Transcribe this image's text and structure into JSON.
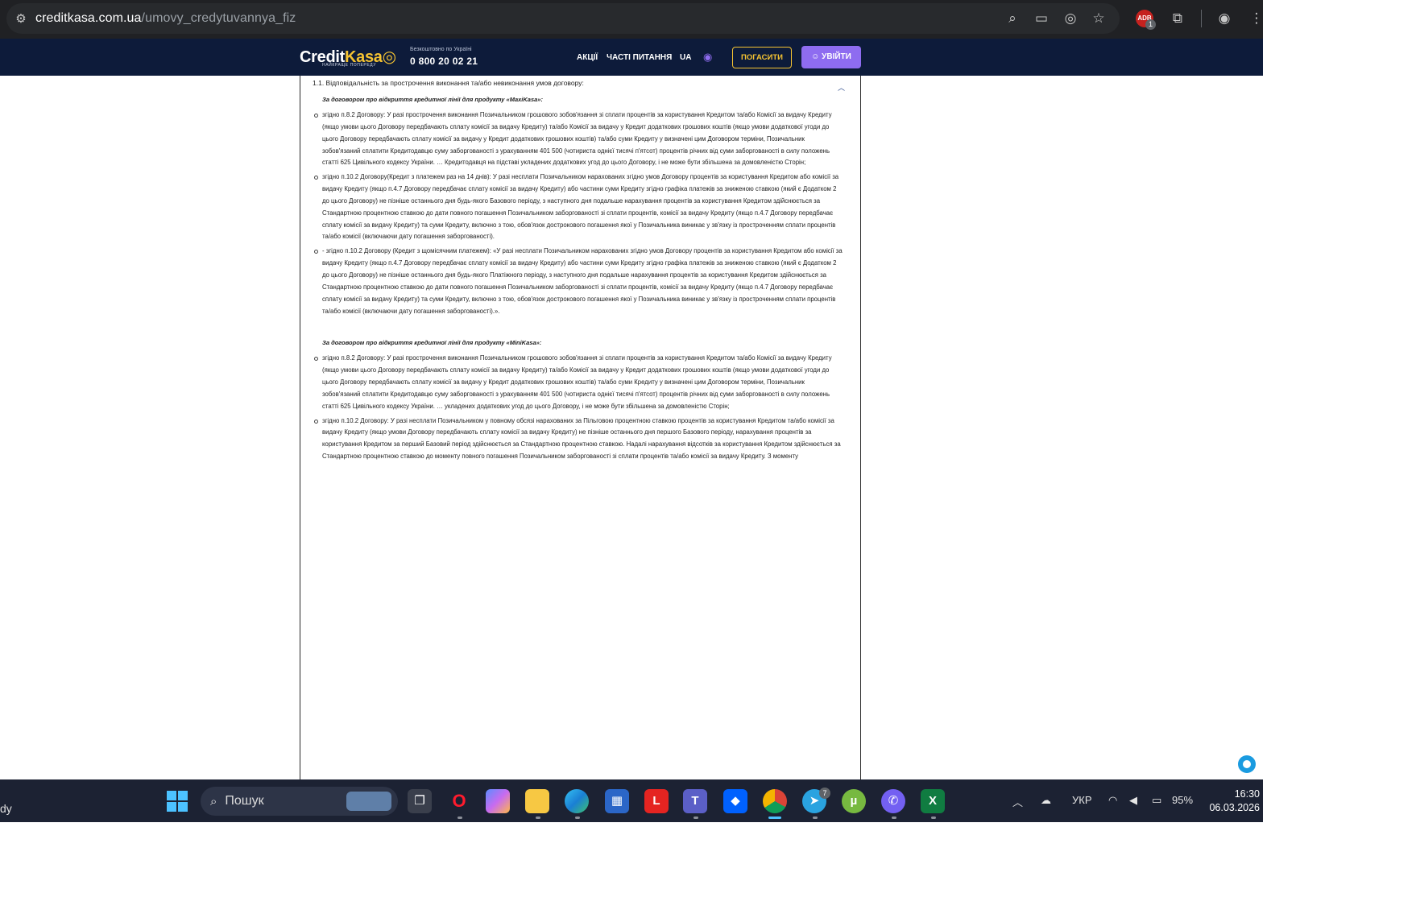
{
  "browser": {
    "url_domain": "creditkasa.com.ua",
    "url_path": "/umovy_credytuvannya_fiz",
    "icons": [
      "site-info-icon",
      "zoom-icon",
      "install-app-icon",
      "eye-slash-icon",
      "star-icon",
      "extension-badge-icon",
      "extensions-icon",
      "profile-icon",
      "menu-icon"
    ],
    "ext_badge_text": "ADB",
    "ext_badge_count": "1"
  },
  "site_header": {
    "logo_credit": "Credit",
    "logo_kasa": "Kasa",
    "logo_tagline": "НАЙКРАЩЕ ПОПЕРЕДУ",
    "phone_label": "Безкоштовно по Україні",
    "phone": "0 800 20 02 21",
    "nav": [
      "АКЦІЇ",
      "ЧАСТІ ПИТАННЯ",
      "UA"
    ],
    "pay_button": "ПОГАСИТИ",
    "login_button": "УВІЙТИ"
  },
  "document": {
    "section_title": "1.1. Відповідальність за прострочення виконання та/або невиконання умов договору:",
    "maxi": {
      "heading": "За договором про відкриття кредитної лінії для продукту «MaxiKasa»:",
      "items": [
        "згідно п.8.2 Договору: У разі прострочення виконання Позичальником грошового зобов'язання зі сплати процентів за користування Кредитом та/або Комісії за видачу Кредиту (якщо умови цього Договору передбачають сплату комісії за видачу Кредиту) та/або Комісії за видачу у Кредит додаткових грошових коштів (якщо умови додаткової угоди до цього Договору передбачають сплату комісії за видачу у Кредит додаткових грошових коштів) та/або суми Кредиту у визначені цим Договором терміни, Позичальник зобов'язаний сплатити Кредитодавцю суму заборгованості з урахуванням 401 500 (чотириста однієї тисячі п'ятсот) процентів річних від суми заборгованості в силу положень статті 625 Цивільного кодексу України. … Кредитодавця на підставі укладених додаткових угод до цього Договору, і не може бути збільшена за домовленістю Сторін;",
        "згідно п.10.2 Договору(Кредит з платежем раз на 14 днів): У разі несплати Позичальником нарахованих згідно умов Договору процентів за користування Кредитом або комісії за видачу Кредиту (якщо п.4.7 Договору передбачає сплату комісії за видачу Кредиту) або частини суми Кредиту згідно графіка платежів за зниженою ставкою (який є Додатком 2 до цього Договору) не пізніше останнього дня будь-якого Базового періоду, з наступного дня подальше нарахування процентів за користування Кредитом здійснюється за Стандартною процентною ставкою до дати повного погашення Позичальником заборгованості зі сплати процентів, комісії за видачу Кредиту (якщо п.4.7 Договору передбачає сплату комісії за видачу Кредиту) та суми Кредиту, включно з тою, обов'язок дострокового погашення якої у Позичальника виникає у зв'язку із простроченням сплати процентів та/або комісії (включаючи дату погашення заборгованості).",
        "- згідно п.10.2 Договору (Кредит з щомісячним платежем): «У разі несплати Позичальником нарахованих згідно умов Договору процентів за користування Кредитом або комісії за видачу Кредиту (якщо п.4.7 Договору передбачає сплату комісії за видачу Кредиту) або частини суми Кредиту згідно графіка платежів за зниженою ставкою (який є Додатком 2 до цього Договору) не пізніше останнього дня будь-якого Платіжного періоду, з наступного дня подальше нарахування процентів за користування Кредитом здійснюється за Стандартною процентною ставкою до дати повного погашення Позичальником заборгованості зі сплати процентів, комісії за видачу Кредиту (якщо п.4.7 Договору передбачає сплату комісії за видачу Кредиту) та суми Кредиту, включно з тою, обов'язок дострокового погашення якої у Позичальника виникає у зв'язку із простроченням сплати процентів та/або комісії (включаючи дату погашення заборгованості).»."
      ]
    },
    "mini": {
      "heading": "За договором про відкриття кредитної лінії для продукту «MiniKasa»:",
      "items": [
        "згідно п.8.2 Договору: У разі прострочення виконання Позичальником грошового зобов'язання зі сплати процентів за користування Кредитом та/або Комісії за видачу Кредиту (якщо умови цього Договору передбачають сплату комісії за видачу Кредиту) та/або Комісії за видачу у Кредит додаткових грошових коштів (якщо умови додаткової угоди до цього Договору передбачають сплату комісії за видачу у Кредит додаткових грошових коштів) та/або суми Кредиту у визначені цим Договором терміни, Позичальник зобов'язаний сплатити Кредитодавцю суму заборгованості з урахуванням 401 500 (чотириста однієї тисячі п'ятсот) процентів річних від суми заборгованості в силу положень статті 625 Цивільного кодексу України. … укладених додаткових угод до цього Договору, і не може бути збільшена за домовленістю Сторін;",
        "згідно п.10.2 Договору: У разі несплати Позичальником у повному обсязі нарахованих за Пільговою процентною ставкою процентів за користування Кредитом та/або комісії за видачу Кредиту (якщо умови Договору передбачають сплату комісії за видачу Кредиту) не пізніше останнього дня першого Базового періоду, нарахування процентів за користування Кредитом за перший Базовий період здійснюється за Стандартною процентною ставкою. Надалі нарахування відсотків за користування Кредитом здійснюється за Стандартною процентною ставкою до моменту повного погашення Позичальником заборгованості зі сплати процентів та/або комісії за видачу Кредиту. З моменту"
      ]
    }
  },
  "taskbar": {
    "left_text": "dy",
    "search_placeholder": "Пошук",
    "apps": [
      "task-view",
      "opera",
      "copilot",
      "file-explorer",
      "edge",
      "store",
      "l-app",
      "teams",
      "dropbox",
      "chrome",
      "telegram",
      "utorrent",
      "viber",
      "excel"
    ],
    "telegram_badge": "7",
    "lang": "УКР",
    "battery": "95%",
    "time": "16:30",
    "date": "06.03.2026"
  }
}
